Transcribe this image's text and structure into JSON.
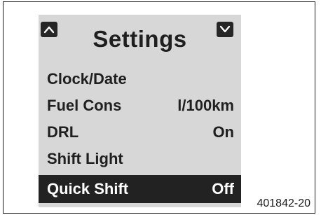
{
  "screen": {
    "title": "Settings",
    "nav": {
      "up_icon": "chevron-up-icon",
      "down_icon": "chevron-down-icon"
    },
    "menu": [
      {
        "label": "Clock/Date",
        "value": "",
        "selected": false
      },
      {
        "label": "Fuel Cons",
        "value": "l/100km",
        "selected": false
      },
      {
        "label": "DRL",
        "value": "On",
        "selected": false
      },
      {
        "label": "Shift Light",
        "value": "",
        "selected": false
      },
      {
        "label": "Quick Shift",
        "value": "Off",
        "selected": true
      }
    ]
  },
  "figure_id": "401842-20",
  "colors": {
    "screen_bg": "#d7d7d7",
    "highlight": "#222222",
    "text": "#1f1f1f"
  }
}
